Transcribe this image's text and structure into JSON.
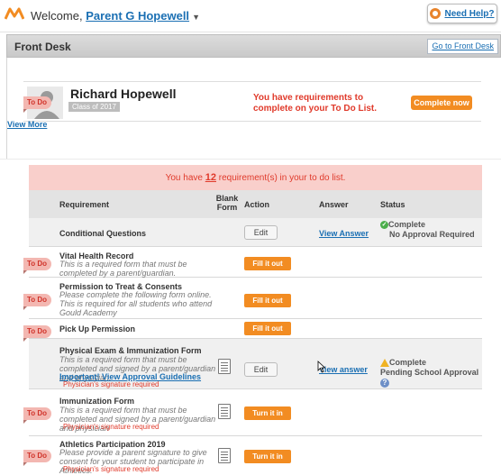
{
  "topbar": {
    "welcome": "Welcome,",
    "user_name": "Parent G Hopewell",
    "help": "Need Help?"
  },
  "front_desk": {
    "title": "Front Desk",
    "link": "Go to Front Desk"
  },
  "student": {
    "todo_tag": "To Do",
    "name": "Richard Hopewell",
    "class": "Class of 2017",
    "message": "You have requirements to complete on your To Do List.",
    "complete_button": "Complete now",
    "view_more": "View More"
  },
  "banner": {
    "prefix": "You have ",
    "count": "12",
    "suffix": " requirement(s) in your to do list."
  },
  "table": {
    "headers": {
      "requirement": "Requirement",
      "blank_form": "Blank Form",
      "action": "Action",
      "answer": "Answer",
      "status": "Status"
    },
    "rows": [
      {
        "title": "Conditional Questions",
        "action": "Edit",
        "answer": "View Answer",
        "status_line1": "Complete",
        "status_line2": "No Approval Required"
      },
      {
        "tag": "To Do",
        "title": "Vital Health Record",
        "desc": "This is a required form that must be completed by a parent/guardian.",
        "action": "Fill it out"
      },
      {
        "tag": "To Do",
        "title": "Permission to Treat & Consents",
        "desc": "Please complete the following form online. This is required for all students who attend Gould Academy",
        "action": "Fill it out"
      },
      {
        "tag": "To Do",
        "title": "Pick Up Permission",
        "action": "Fill it out"
      },
      {
        "title": "Physical Exam & Immunization Form",
        "desc": "This is a required form that must be completed and signed by a parent/guardian and physician.",
        "guide": "Important! View Approval Guidelines",
        "sig": "Physician's signature required",
        "action": "Edit",
        "answer": "View answer",
        "status_line1": "Complete",
        "status_line2": "Pending School Approval"
      },
      {
        "tag": "To Do",
        "title": "Immunization Form",
        "desc": "This is a required form that must be completed and signed by a parent/guardian and physician",
        "sig": "Physician's signature required",
        "action": "Turn it in"
      },
      {
        "tag": "To Do",
        "title": "Athletics Participation 2019",
        "desc": "Please provide a parent signature to give consent for your student to participate in Athletics.",
        "sig": "Physician's signature required",
        "action": "Turn it in"
      }
    ]
  },
  "colors": {
    "accent_orange": "#f28c22",
    "link_blue": "#1a6fb3",
    "alert_red": "#e03a2b",
    "banner_pink": "#f9cfcb"
  }
}
